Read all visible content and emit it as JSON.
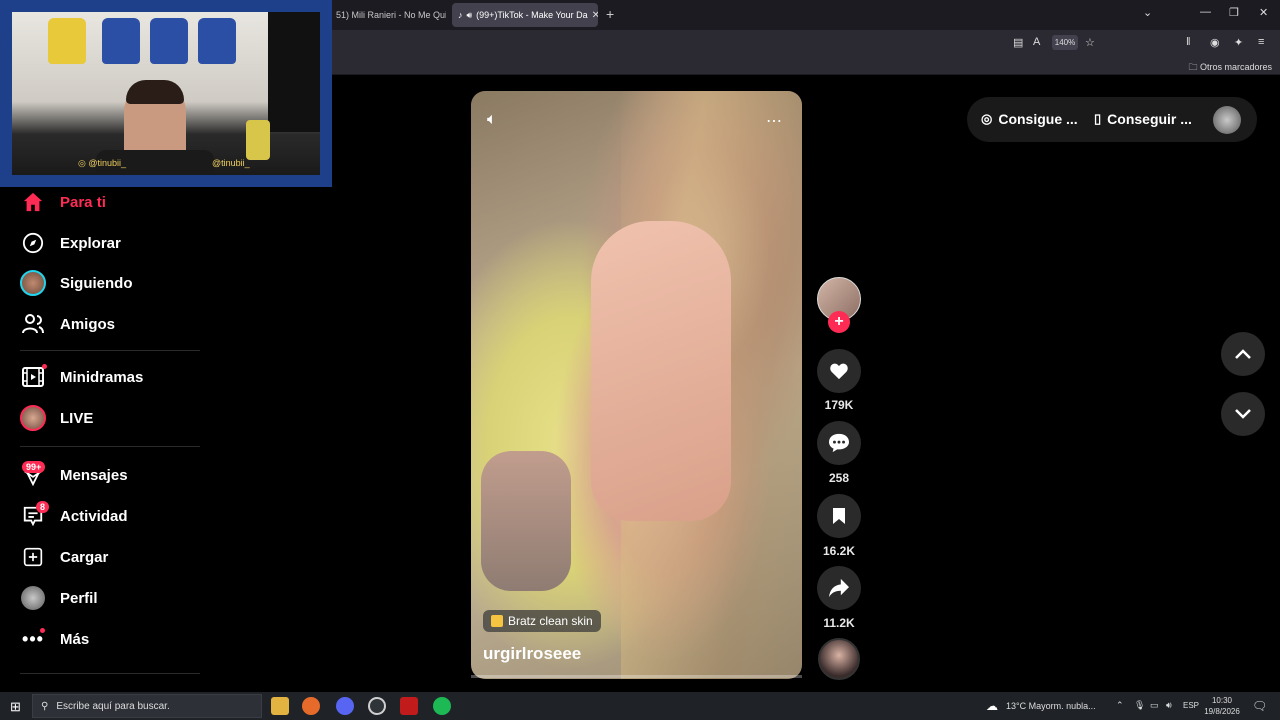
{
  "browser": {
    "tabs": [
      {
        "label": "51) Mili Ranieri - No Me Qui",
        "active": false
      },
      {
        "label": "(99+)TikTok - Make Your Da",
        "active": true
      }
    ],
    "zoom": "140%",
    "bookmarks_folder": "Otros marcadores"
  },
  "webcam": {
    "handle_left": "@tinubii_",
    "handle_right": "@tinubii_"
  },
  "sidebar": {
    "items": [
      {
        "label": "Para ti",
        "icon": "home-icon",
        "active": true
      },
      {
        "label": "Explorar",
        "icon": "compass-icon"
      },
      {
        "label": "Siguiendo",
        "icon": "following-avatar-icon"
      },
      {
        "label": "Amigos",
        "icon": "friends-icon"
      },
      {
        "label": "Minidramas",
        "icon": "film-icon"
      },
      {
        "label": "LIVE",
        "icon": "live-avatar-icon"
      },
      {
        "label": "Mensajes",
        "icon": "messages-icon",
        "badge": "99+"
      },
      {
        "label": "Actividad",
        "icon": "activity-icon",
        "badge": "8"
      },
      {
        "label": "Cargar",
        "icon": "upload-icon"
      },
      {
        "label": "Perfil",
        "icon": "profile-avatar-icon"
      },
      {
        "label": "Más",
        "icon": "more-dots-icon"
      }
    ]
  },
  "video": {
    "tag": "Bratz clean skin",
    "author": "urgirlroseee"
  },
  "actions": {
    "likes": "179K",
    "comments": "258",
    "saves": "16.2K",
    "shares": "11.2K"
  },
  "topright": {
    "pill1": "Consigue ...",
    "pill2": "Conseguir ..."
  },
  "taskbar": {
    "search_placeholder": "Escribe aquí para buscar.",
    "weather": "13°C  Mayorm. nubla...",
    "lang": "ESP",
    "time": "10:30",
    "date": "19/8/2026"
  },
  "colors": {
    "accent": "#fe2c55",
    "webcam_frame": "#1e3f8a"
  }
}
